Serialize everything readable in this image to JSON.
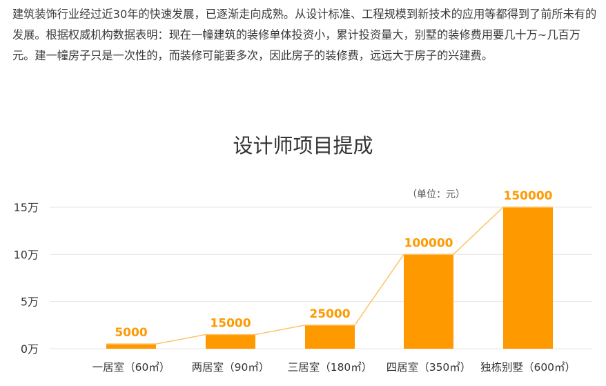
{
  "intro_text": "建筑装饰行业经过近30年的快速发展，已逐渐走向成熟。从设计标准、工程规模到新技术的应用等都得到了前所未有的发展。根据权威机构数据表明：现在一幢建筑的装修单体投资小，累计投资量大，别墅的装修费用要几十万~几百万元。建一幢房子只是一次性的，而装修可能要多次，因此房子的装修费，远远大于房子的兴建费。",
  "colors": {
    "bar": "#ff9900",
    "line": "#ffc266",
    "grid": "#e6e6e6",
    "axis_text": "#333333"
  },
  "chart_data": {
    "type": "bar",
    "title": "设计师项目提成",
    "unit_note": "（单位：元）",
    "categories": [
      "一居室（60㎡）",
      "两居室（90㎡）",
      "三居室（180㎡）",
      "四居室（350㎡）",
      "独栋别墅（600㎡）"
    ],
    "values": [
      5000,
      15000,
      25000,
      100000,
      150000
    ],
    "value_labels": [
      "5000",
      "15000",
      "25000",
      "100000",
      "150000"
    ],
    "yticks": [
      0,
      50000,
      100000,
      150000
    ],
    "ytick_labels": [
      "0万",
      "5万",
      "10万",
      "15万"
    ],
    "ylim": [
      0,
      150000
    ],
    "grid": true,
    "trend_line": true
  }
}
